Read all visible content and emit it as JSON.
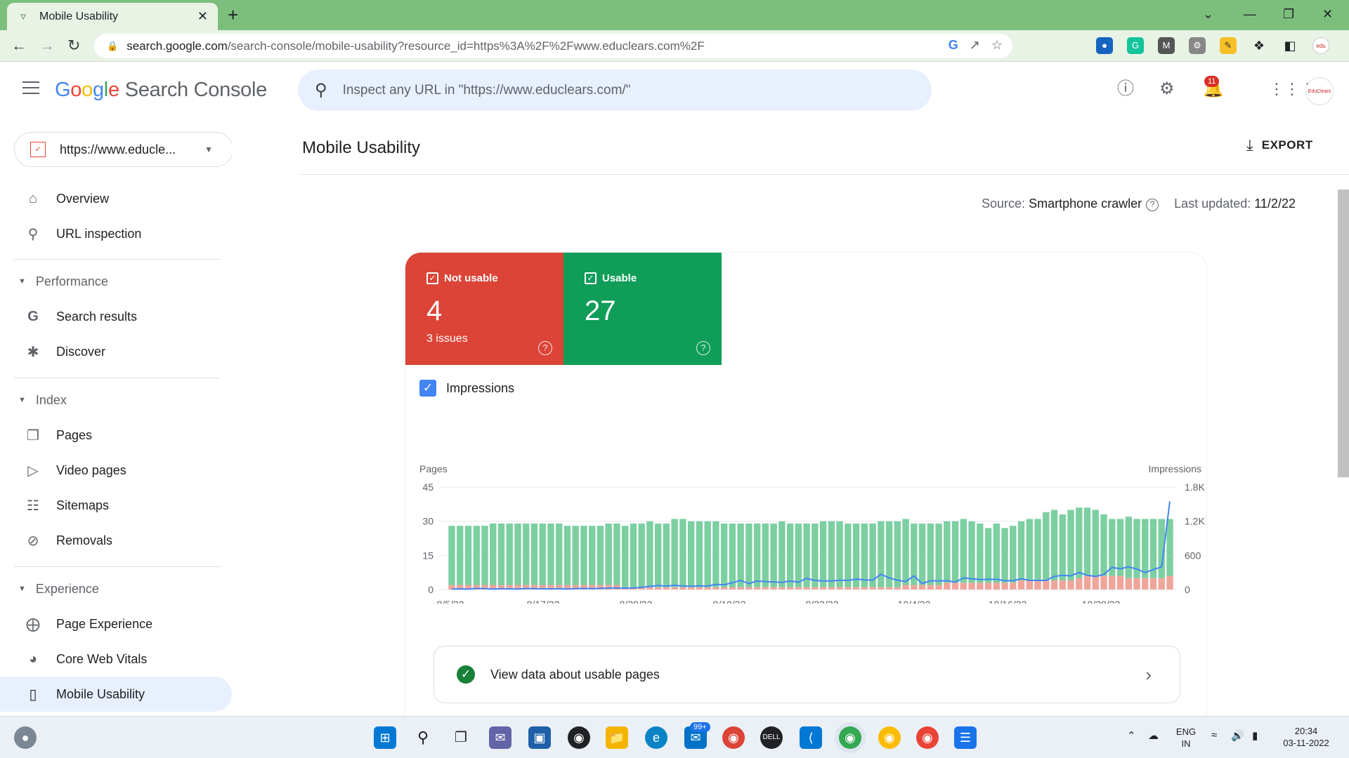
{
  "browser": {
    "tab_title": "Mobile Usability",
    "url_host": "search.google.com",
    "url_path": "/search-console/mobile-usability?resource_id=https%3A%2F%2Fwww.educlears.com%2F"
  },
  "header": {
    "product_name": "Search Console",
    "search_placeholder": "Inspect any URL in \"https://www.educlears.com/\"",
    "notification_count": "11"
  },
  "sidebar": {
    "property": "https://www.educle...",
    "items": [
      {
        "label": "Overview"
      },
      {
        "label": "URL inspection"
      },
      {
        "label": "Performance"
      },
      {
        "label": "Search results"
      },
      {
        "label": "Discover"
      },
      {
        "label": "Index"
      },
      {
        "label": "Pages"
      },
      {
        "label": "Video pages"
      },
      {
        "label": "Sitemaps"
      },
      {
        "label": "Removals"
      },
      {
        "label": "Experience"
      },
      {
        "label": "Page Experience"
      },
      {
        "label": "Core Web Vitals"
      },
      {
        "label": "Mobile Usability"
      }
    ]
  },
  "main": {
    "title": "Mobile Usability",
    "export_label": "EXPORT",
    "source_label": "Source:",
    "source_value": "Smartphone crawler",
    "updated_label": "Last updated:",
    "updated_value": "11/2/22",
    "tiles": {
      "not_usable": {
        "label": "Not usable",
        "value": "4",
        "sub": "3 issues"
      },
      "usable": {
        "label": "Usable",
        "value": "27"
      }
    },
    "impressions_label": "Impressions",
    "usable_link": "View data about usable pages"
  },
  "chart_data": {
    "type": "bar",
    "ylabel": "Pages",
    "y2label": "Impressions",
    "ylim": [
      0,
      45
    ],
    "y2lim": [
      0,
      1800
    ],
    "yticks": [
      "0",
      "15",
      "30",
      "45"
    ],
    "y2ticks": [
      "0",
      "600",
      "1.2K",
      "1.8K"
    ],
    "xticks": [
      "8/5/22",
      "8/17/22",
      "8/29/22",
      "9/10/22",
      "9/22/22",
      "10/4/22",
      "10/16/22",
      "10/28/22"
    ],
    "colors": {
      "usable": "#7ccfa1",
      "not_usable": "#f0a59b",
      "impressions": "#4285f4"
    },
    "series": [
      {
        "name": "Usable",
        "values": [
          26,
          26,
          26,
          26,
          26,
          27,
          27,
          27,
          27,
          27,
          27,
          27,
          27,
          27,
          26,
          26,
          26,
          26,
          26,
          27,
          27,
          27,
          28,
          28,
          29,
          28,
          28,
          30,
          30,
          29,
          29,
          29,
          29,
          28,
          28,
          28,
          28,
          28,
          28,
          28,
          29,
          28,
          28,
          28,
          28,
          29,
          29,
          29,
          28,
          28,
          28,
          28,
          29,
          29,
          29,
          29,
          27,
          27,
          27,
          27,
          27,
          27,
          28,
          27,
          26,
          24,
          26,
          24,
          25,
          26,
          27,
          27,
          30,
          31,
          29,
          31,
          31,
          30,
          29,
          27,
          25,
          25,
          27,
          26,
          26,
          26,
          26,
          25
        ]
      },
      {
        "name": "Not usable",
        "values": [
          2,
          2,
          2,
          2,
          2,
          2,
          2,
          2,
          2,
          2,
          2,
          2,
          2,
          2,
          2,
          2,
          2,
          2,
          2,
          2,
          2,
          1,
          1,
          1,
          1,
          1,
          1,
          1,
          1,
          1,
          1,
          1,
          1,
          1,
          1,
          1,
          1,
          1,
          1,
          1,
          1,
          1,
          1,
          1,
          1,
          1,
          1,
          1,
          1,
          1,
          1,
          1,
          1,
          1,
          1,
          2,
          2,
          2,
          2,
          2,
          3,
          3,
          3,
          3,
          3,
          3,
          3,
          3,
          3,
          4,
          4,
          4,
          4,
          4,
          4,
          4,
          5,
          6,
          6,
          6,
          6,
          6,
          5,
          5,
          5,
          5,
          5,
          6
        ]
      },
      {
        "name": "Impressions",
        "values": [
          10,
          12,
          8,
          20,
          15,
          10,
          15,
          12,
          10,
          18,
          15,
          14,
          12,
          15,
          10,
          18,
          20,
          15,
          22,
          25,
          30,
          25,
          28,
          40,
          55,
          70,
          60,
          75,
          62,
          58,
          65,
          60,
          90,
          85,
          120,
          160,
          105,
          150,
          140,
          135,
          125,
          150,
          130,
          195,
          160,
          150,
          152,
          165,
          160,
          185,
          170,
          165,
          270,
          205,
          165,
          140,
          240,
          105,
          155,
          150,
          155,
          130,
          205,
          190,
          175,
          180,
          180,
          155,
          155,
          190,
          160,
          160,
          160,
          230,
          250,
          240,
          300,
          250,
          230,
          265,
          390,
          365,
          400,
          360,
          300,
          350,
          400,
          510
        ]
      }
    ],
    "impressions_peak_last": 1550
  },
  "taskbar": {
    "lang": "ENG",
    "region": "IN",
    "time": "20:34",
    "date": "03-11-2022",
    "mail_badge": "99+"
  }
}
